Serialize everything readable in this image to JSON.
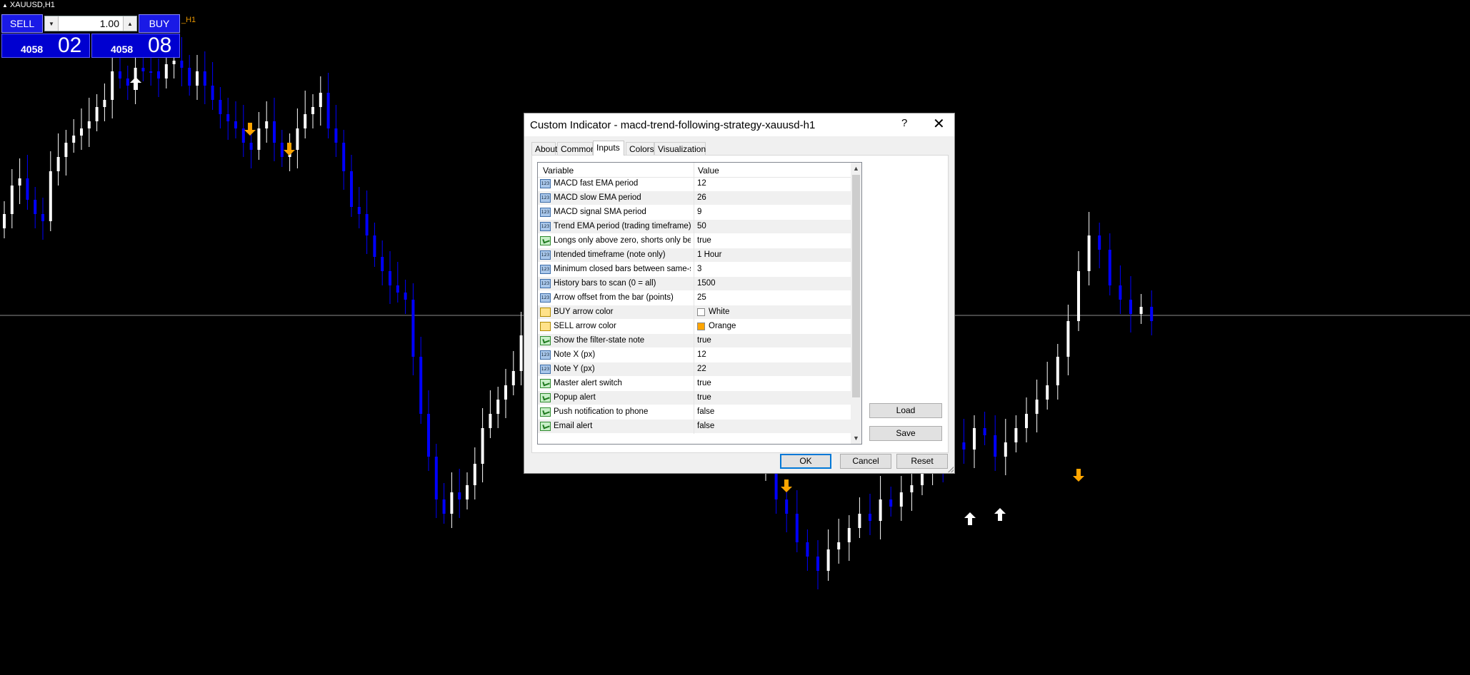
{
  "chart": {
    "symbol_label": "XAUUSD,H1",
    "indicator_tag": "_H1",
    "colors": {
      "bull": "#ffffff",
      "bear": "#0000ff",
      "buy_arrow": "#ffffff",
      "sell_arrow": "#ffa500",
      "background": "#000000"
    },
    "series": {
      "opens": [
        320,
        300,
        260,
        250,
        280,
        300,
        310,
        240,
        220,
        200,
        190,
        180,
        170,
        150,
        140,
        100,
        110,
        120,
        95,
        100,
        100,
        110,
        90,
        85,
        95,
        120,
        100,
        120,
        140,
        160,
        170,
        180,
        200,
        210,
        180,
        170,
        200,
        220,
        210,
        180,
        160,
        150,
        130,
        180,
        200,
        240,
        290,
        300,
        330,
        360,
        380,
        400,
        410,
        420,
        500,
        580,
        640,
        700,
        720,
        690,
        700,
        680,
        650,
        600,
        580,
        560,
        540,
        520
      ],
      "closes": [
        300,
        260,
        250,
        280,
        300,
        310,
        240,
        220,
        200,
        190,
        180,
        170,
        150,
        140,
        100,
        110,
        120,
        95,
        100,
        100,
        110,
        90,
        85,
        95,
        120,
        100,
        120,
        140,
        160,
        170,
        180,
        200,
        210,
        180,
        170,
        200,
        220,
        210,
        180,
        160,
        150,
        130,
        180,
        200,
        240,
        290,
        300,
        330,
        360,
        380,
        400,
        410,
        420,
        500,
        580,
        640,
        700,
        720,
        690,
        700,
        680,
        650,
        600,
        580,
        560,
        540,
        520,
        470
      ]
    },
    "series_right": {
      "opens": [
        660,
        650,
        700,
        720,
        760,
        780,
        800,
        770,
        760,
        740,
        720,
        730,
        700,
        710,
        690,
        680,
        660,
        640,
        650,
        620,
        630,
        600,
        610,
        640,
        620,
        600,
        580,
        560,
        540,
        500,
        450,
        380,
        330,
        350,
        400,
        420,
        440,
        430
      ],
      "closes": [
        650,
        700,
        720,
        760,
        780,
        800,
        770,
        760,
        740,
        720,
        730,
        700,
        710,
        690,
        680,
        660,
        640,
        650,
        620,
        630,
        600,
        610,
        640,
        620,
        600,
        580,
        560,
        540,
        500,
        450,
        380,
        330,
        350,
        400,
        420,
        440,
        430,
        450
      ]
    },
    "buy_arrows": [
      {
        "x": 190,
        "y": 118
      },
      {
        "x": 1358,
        "y": 728
      },
      {
        "x": 1400,
        "y": 722
      }
    ],
    "sell_arrows": [
      {
        "x": 350,
        "y": 180
      },
      {
        "x": 405,
        "y": 208
      },
      {
        "x": 1101,
        "y": 680
      },
      {
        "x": 1510,
        "y": 665
      }
    ]
  },
  "trade_panel": {
    "sell_label": "SELL",
    "buy_label": "BUY",
    "lot": "1.00",
    "sell_price_small": "4058",
    "sell_price_big": "02",
    "buy_price_small": "4058",
    "buy_price_big": "08"
  },
  "dialog": {
    "title": "Custom Indicator - macd-trend-following-strategy-xauusd-h1",
    "help": "?",
    "close": "✕",
    "tabs": [
      "About",
      "Common",
      "Inputs",
      "Colors",
      "Visualization"
    ],
    "active_tab": "Inputs",
    "columns": {
      "variable": "Variable",
      "value": "Value"
    },
    "rows": [
      {
        "name": "MACD fast EMA period",
        "value": "12",
        "icon": "int"
      },
      {
        "name": "MACD slow EMA period",
        "value": "26",
        "icon": "int"
      },
      {
        "name": "MACD signal SMA period",
        "value": "9",
        "icon": "int"
      },
      {
        "name": "Trend EMA period (trading timeframe)",
        "value": "50",
        "icon": "int"
      },
      {
        "name": "Longs only above zero, shorts only be...",
        "value": "true",
        "icon": "bool"
      },
      {
        "name": "Intended timeframe (note only)",
        "value": "1 Hour",
        "icon": "int"
      },
      {
        "name": "Minimum closed bars between same-si...",
        "value": "3",
        "icon": "int"
      },
      {
        "name": "History bars to scan (0 = all)",
        "value": "1500",
        "icon": "int"
      },
      {
        "name": "Arrow offset from the bar (points)",
        "value": "25",
        "icon": "int"
      },
      {
        "name": "BUY arrow color",
        "value": "White",
        "icon": "color",
        "swatch": "#ffffff"
      },
      {
        "name": "SELL arrow color",
        "value": "Orange",
        "icon": "color",
        "swatch": "#ffa500"
      },
      {
        "name": "Show the filter-state note",
        "value": "true",
        "icon": "bool"
      },
      {
        "name": "Note X (px)",
        "value": "12",
        "icon": "int"
      },
      {
        "name": "Note Y (px)",
        "value": "22",
        "icon": "int"
      },
      {
        "name": "Master alert switch",
        "value": "true",
        "icon": "bool"
      },
      {
        "name": "Popup alert",
        "value": "true",
        "icon": "bool"
      },
      {
        "name": "Push notification to phone",
        "value": "false",
        "icon": "bool"
      },
      {
        "name": "Email alert",
        "value": "false",
        "icon": "bool"
      }
    ],
    "buttons": {
      "load": "Load",
      "save": "Save",
      "ok": "OK",
      "cancel": "Cancel",
      "reset": "Reset"
    }
  }
}
